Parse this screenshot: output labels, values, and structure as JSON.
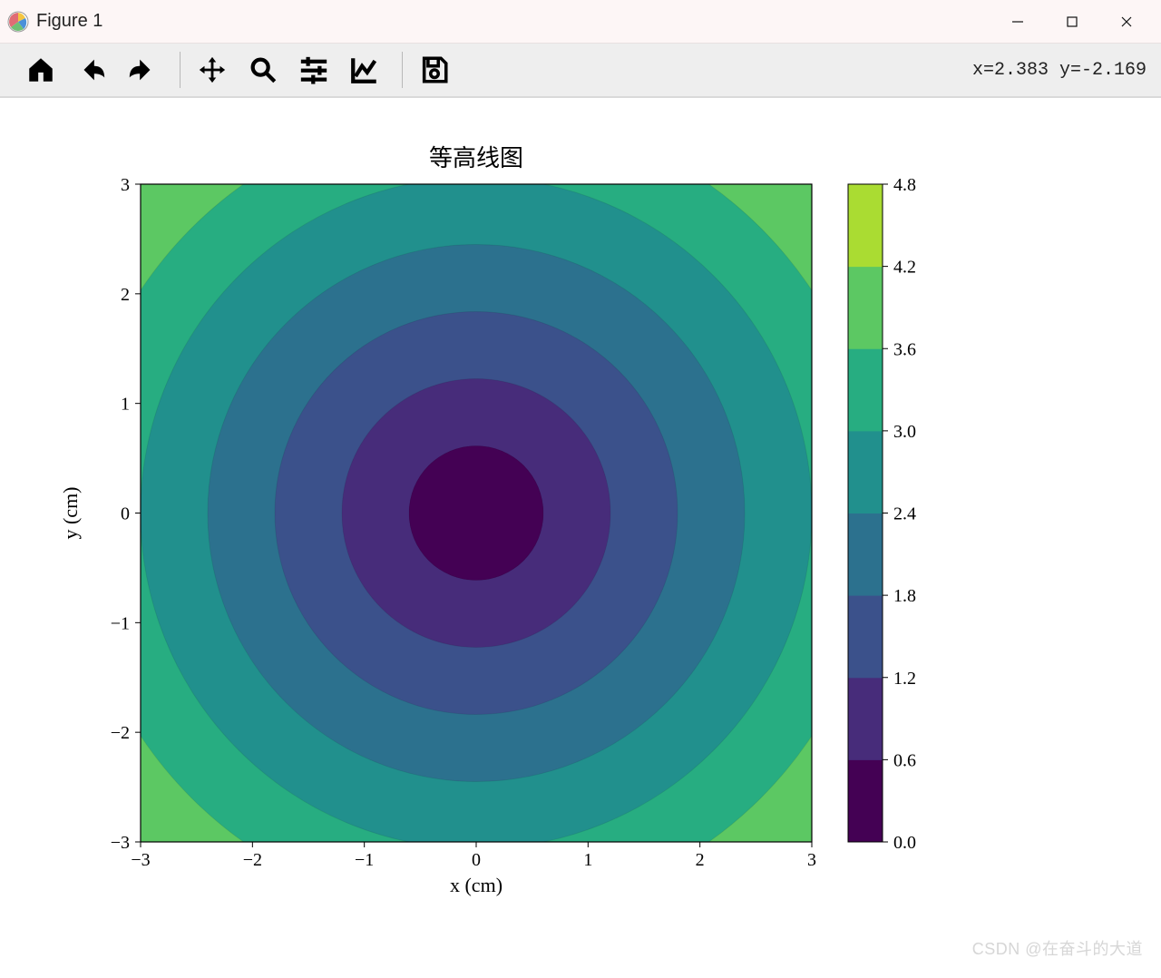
{
  "window": {
    "title": "Figure 1",
    "minimize_tooltip": "Minimize",
    "maximize_tooltip": "Maximize",
    "close_tooltip": "Close"
  },
  "toolbar": {
    "home_tooltip": "Home",
    "back_tooltip": "Back",
    "forward_tooltip": "Forward",
    "pan_tooltip": "Pan",
    "zoom_tooltip": "Zoom",
    "subplots_tooltip": "Configure subplots",
    "axes_tooltip": "Edit axis",
    "save_tooltip": "Save",
    "coord_readout": "x=2.383 y=-2.169"
  },
  "watermark": "CSDN @在奋斗的大道",
  "chart_data": {
    "type": "contourf",
    "title": "等高线图",
    "xlabel": "x (cm)",
    "ylabel": "y (cm)",
    "xlim": [
      -3,
      3
    ],
    "ylim": [
      -3,
      3
    ],
    "x_ticks": [
      -3,
      -2,
      -1,
      0,
      1,
      2,
      3
    ],
    "y_ticks": [
      -3,
      -2,
      -1,
      0,
      1,
      2,
      3
    ],
    "function": "z = sqrt(x^2 + y^2)",
    "contour_levels": [
      0.0,
      0.6,
      1.2,
      1.8,
      2.4,
      3.0,
      3.6,
      4.2,
      4.8
    ],
    "colorbar": {
      "ticks": [
        0.0,
        0.6,
        1.2,
        1.8,
        2.4,
        3.0,
        3.6,
        4.2,
        4.8
      ],
      "labels": [
        "0.0",
        "0.6",
        "1.2",
        "1.8",
        "2.4",
        "3.0",
        "3.6",
        "4.2",
        "4.8"
      ]
    },
    "colormap": "viridis",
    "level_colors": [
      "#440154",
      "#472c7a",
      "#3b518b",
      "#2c718e",
      "#21908d",
      "#27ad81",
      "#5cc863",
      "#aadc32"
    ]
  }
}
